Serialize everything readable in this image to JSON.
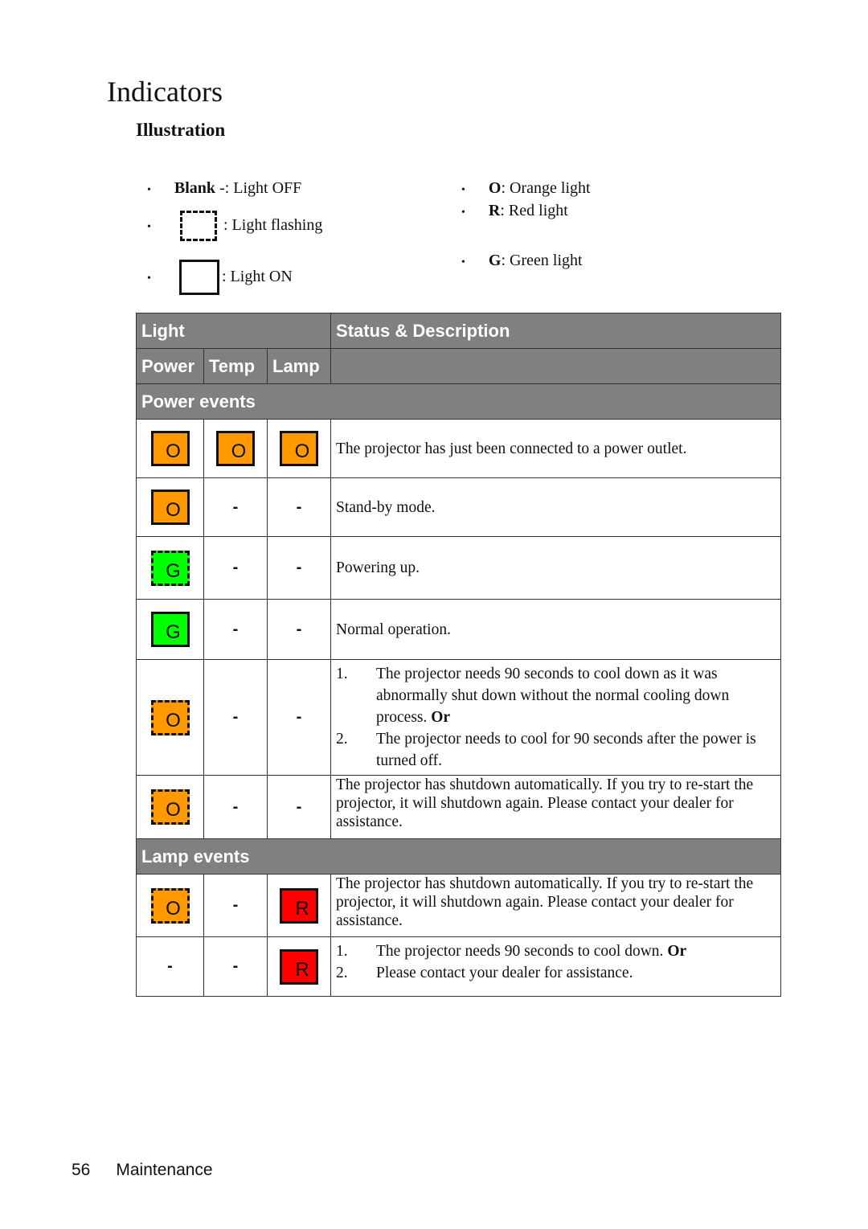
{
  "page": {
    "title": "Indicators",
    "subtitle": "Illustration"
  },
  "legend": {
    "left": [
      {
        "bold": "Blank",
        "text": " -: Light OFF",
        "symbol": "none"
      },
      {
        "bold": "",
        "text": ": Light flashing",
        "symbol": "flash"
      },
      {
        "bold": "",
        "text": ": Light ON",
        "symbol": "on"
      }
    ],
    "right": [
      {
        "bold": "O",
        "text": ": Orange light"
      },
      {
        "bold": "R",
        "text": ": Red light"
      },
      {
        "bold": "G",
        "text": ": Green light"
      }
    ],
    "bullet": "•"
  },
  "colors": {
    "orange": "#FF9900",
    "green": "#00FF00",
    "red": "#FF0000",
    "header_gray": "#808080"
  },
  "table": {
    "header": {
      "light": "Light",
      "status": "Status & Description",
      "power": "Power",
      "temp": "Temp",
      "lamp": "Lamp"
    },
    "sections": [
      {
        "title": "Power events",
        "rows": [
          {
            "power": {
              "letter": "O",
              "color": "orange",
              "mode": "on"
            },
            "temp": {
              "letter": "O",
              "color": "orange",
              "mode": "on"
            },
            "lamp": {
              "letter": "O",
              "color": "orange",
              "mode": "on"
            },
            "description": "The projector has just been connected to a power outlet."
          },
          {
            "power": {
              "letter": "O",
              "color": "orange",
              "mode": "on"
            },
            "temp": {
              "mode": "off",
              "text": "-"
            },
            "lamp": {
              "mode": "off",
              "text": "-"
            },
            "description": "Stand-by mode."
          },
          {
            "power": {
              "letter": "G",
              "color": "green",
              "mode": "flash"
            },
            "temp": {
              "mode": "off",
              "text": "-"
            },
            "lamp": {
              "mode": "off",
              "text": "-"
            },
            "description": "Powering up."
          },
          {
            "power": {
              "letter": "G",
              "color": "green",
              "mode": "on"
            },
            "temp": {
              "mode": "off",
              "text": "-"
            },
            "lamp": {
              "mode": "off",
              "text": "-"
            },
            "description": "Normal operation."
          },
          {
            "power": {
              "letter": "O",
              "color": "orange",
              "mode": "flash"
            },
            "temp": {
              "mode": "off",
              "text": "-"
            },
            "lamp": {
              "mode": "off",
              "text": "-"
            },
            "list": [
              {
                "num": "1.",
                "text": "The projector needs 90 seconds to cool down as it was abnormally shut down without the normal cooling down process.",
                "suffix_bold": "Or"
              },
              {
                "num": "2.",
                "text": "The projector needs to cool for 90 seconds after the power is turned off.",
                "suffix_bold": ""
              }
            ]
          },
          {
            "power": {
              "letter": "O",
              "color": "orange",
              "mode": "flash"
            },
            "temp": {
              "mode": "off",
              "text": "-"
            },
            "lamp": {
              "mode": "off",
              "text": "-"
            },
            "description": "The projector has shutdown automatically. If you try to re-start the projector, it will shutdown again. Please contact your dealer for assistance."
          }
        ]
      },
      {
        "title": "Lamp events",
        "rows": [
          {
            "power": {
              "letter": "O",
              "color": "orange",
              "mode": "flash"
            },
            "temp": {
              "mode": "off",
              "text": "-"
            },
            "lamp": {
              "letter": "R",
              "color": "red",
              "mode": "on"
            },
            "description": "The projector has shutdown automatically. If you try to re-start the projector, it will shutdown again. Please contact your dealer for assistance."
          },
          {
            "power": {
              "mode": "off",
              "text": "-"
            },
            "temp": {
              "mode": "off",
              "text": "-"
            },
            "lamp": {
              "letter": "R",
              "color": "red",
              "mode": "on"
            },
            "list": [
              {
                "num": "1.",
                "text": "The projector needs 90 seconds to cool down.",
                "suffix_bold": "Or"
              },
              {
                "num": "2.",
                "text": "Please contact your dealer for assistance.",
                "suffix_bold": ""
              }
            ]
          }
        ]
      }
    ]
  },
  "footer": {
    "page_number": "56",
    "section": "Maintenance"
  }
}
